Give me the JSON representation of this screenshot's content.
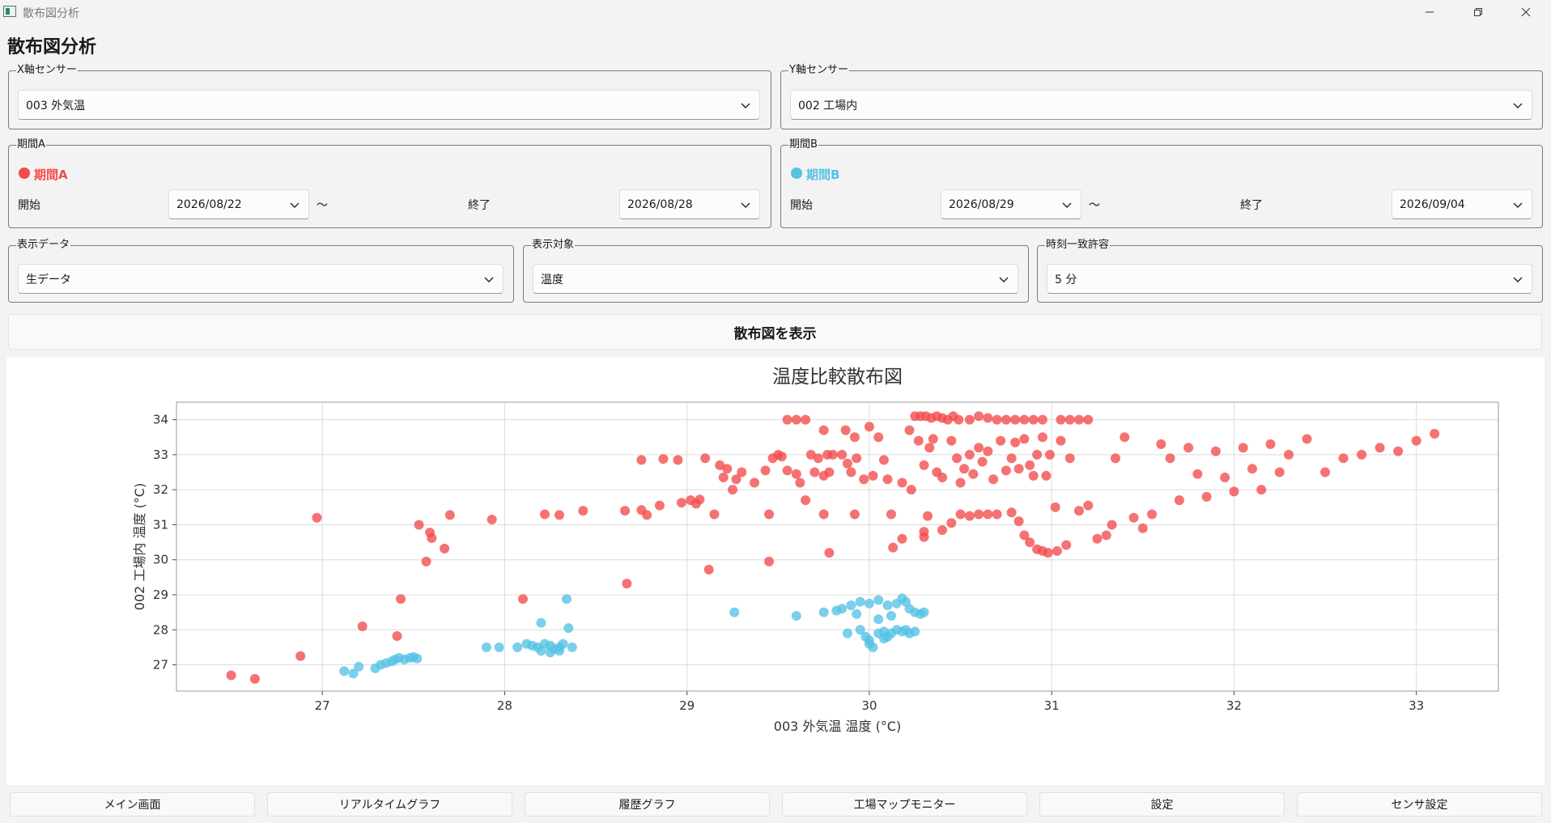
{
  "window": {
    "title": "散布図分析",
    "minimize_icon": "minimize-icon",
    "maximize_icon": "restore-icon",
    "close_icon": "close-icon"
  },
  "page_title": "散布図分析",
  "x_sensor": {
    "legend": "X軸センサー",
    "value": "003 外気温"
  },
  "y_sensor": {
    "legend": "Y軸センサー",
    "value": "002 工場内"
  },
  "period_a": {
    "legend": "期間A",
    "name": "期間A",
    "color": "#f44a4a",
    "start_label": "開始",
    "tilde": "〜",
    "end_label": "終了",
    "start": "2026/08/22",
    "end": "2026/08/28"
  },
  "period_b": {
    "legend": "期間B",
    "name": "期間B",
    "color": "#55c2e4",
    "start_label": "開始",
    "tilde": "〜",
    "end_label": "終了",
    "start": "2026/08/29",
    "end": "2026/09/04"
  },
  "display_data": {
    "legend": "表示データ",
    "value": "生データ"
  },
  "display_target": {
    "legend": "表示対象",
    "value": "温度"
  },
  "time_tolerance": {
    "legend": "時刻一致許容",
    "value": "5 分"
  },
  "show_button": "散布図を表示",
  "nav": [
    "メイン画面",
    "リアルタイムグラフ",
    "履歴グラフ",
    "工場マップモニター",
    "設定",
    "センサ設定"
  ],
  "chart_data": {
    "type": "scatter",
    "title": "温度比較散布図",
    "xlabel": "003 外気温 温度 (°C)",
    "ylabel": "002 工場内 温度 (°C)",
    "xlim": [
      26.2,
      33.45
    ],
    "ylim": [
      26.25,
      34.5
    ],
    "xticks": [
      27,
      28,
      29,
      30,
      31,
      32,
      33
    ],
    "yticks": [
      27,
      28,
      29,
      30,
      31,
      32,
      33,
      34
    ],
    "grid": true,
    "series": [
      {
        "period": "A",
        "color": "#f44a4a",
        "points": [
          [
            26.5,
            26.7
          ],
          [
            26.63,
            26.6
          ],
          [
            26.88,
            27.25
          ],
          [
            26.97,
            31.2
          ],
          [
            27.22,
            28.1
          ],
          [
            27.41,
            27.82
          ],
          [
            27.43,
            28.88
          ],
          [
            27.53,
            31.0
          ],
          [
            27.57,
            29.95
          ],
          [
            27.59,
            30.78
          ],
          [
            27.6,
            30.62
          ],
          [
            27.67,
            30.32
          ],
          [
            27.7,
            31.28
          ],
          [
            27.93,
            31.15
          ],
          [
            28.1,
            28.88
          ],
          [
            28.22,
            31.3
          ],
          [
            28.3,
            31.28
          ],
          [
            28.43,
            31.4
          ],
          [
            28.66,
            31.4
          ],
          [
            28.67,
            29.32
          ],
          [
            28.75,
            31.42
          ],
          [
            28.78,
            31.28
          ],
          [
            28.85,
            31.55
          ],
          [
            28.75,
            32.85
          ],
          [
            28.87,
            32.88
          ],
          [
            28.95,
            32.85
          ],
          [
            28.97,
            31.63
          ],
          [
            29.02,
            31.7
          ],
          [
            29.05,
            31.6
          ],
          [
            29.07,
            31.72
          ],
          [
            29.1,
            32.9
          ],
          [
            29.12,
            29.72
          ],
          [
            29.15,
            31.3
          ],
          [
            29.18,
            32.7
          ],
          [
            29.2,
            32.35
          ],
          [
            29.22,
            32.6
          ],
          [
            29.25,
            32.0
          ],
          [
            29.27,
            32.3
          ],
          [
            29.3,
            32.5
          ],
          [
            29.37,
            32.2
          ],
          [
            29.43,
            32.55
          ],
          [
            29.45,
            29.95
          ],
          [
            29.45,
            31.3
          ],
          [
            29.47,
            32.9
          ],
          [
            29.5,
            33.0
          ],
          [
            29.55,
            32.55
          ],
          [
            29.6,
            32.45
          ],
          [
            29.62,
            32.2
          ],
          [
            29.65,
            31.7
          ],
          [
            29.7,
            32.5
          ],
          [
            29.75,
            32.4
          ],
          [
            29.52,
            32.95
          ],
          [
            29.68,
            33.0
          ],
          [
            29.72,
            32.9
          ],
          [
            29.77,
            33.0
          ],
          [
            29.8,
            33.0
          ],
          [
            29.78,
            32.5
          ],
          [
            29.85,
            33.0
          ],
          [
            29.88,
            32.75
          ],
          [
            29.9,
            32.5
          ],
          [
            29.93,
            32.9
          ],
          [
            29.97,
            32.3
          ],
          [
            29.75,
            33.7
          ],
          [
            29.87,
            33.7
          ],
          [
            29.92,
            33.5
          ],
          [
            29.75,
            31.3
          ],
          [
            29.78,
            30.2
          ],
          [
            29.92,
            31.3
          ],
          [
            30.0,
            33.8
          ],
          [
            30.02,
            32.4
          ],
          [
            30.05,
            33.5
          ],
          [
            30.08,
            32.85
          ],
          [
            30.1,
            32.3
          ],
          [
            30.12,
            31.3
          ],
          [
            30.13,
            30.35
          ],
          [
            30.18,
            32.2
          ],
          [
            30.22,
            33.7
          ],
          [
            30.23,
            32.0
          ],
          [
            30.27,
            33.4
          ],
          [
            30.3,
            32.7
          ],
          [
            30.33,
            33.2
          ],
          [
            30.35,
            33.45
          ],
          [
            30.37,
            32.5
          ],
          [
            30.4,
            32.35
          ],
          [
            30.45,
            33.4
          ],
          [
            30.48,
            32.9
          ],
          [
            30.5,
            32.2
          ],
          [
            30.52,
            32.6
          ],
          [
            30.55,
            33.0
          ],
          [
            30.57,
            32.45
          ],
          [
            30.6,
            33.2
          ],
          [
            30.62,
            32.8
          ],
          [
            30.65,
            33.1
          ],
          [
            30.68,
            32.3
          ],
          [
            30.72,
            33.4
          ],
          [
            30.75,
            32.55
          ],
          [
            30.78,
            32.9
          ],
          [
            30.8,
            33.35
          ],
          [
            30.82,
            32.6
          ],
          [
            30.85,
            33.45
          ],
          [
            30.88,
            32.7
          ],
          [
            30.9,
            32.4
          ],
          [
            30.92,
            33.0
          ],
          [
            30.95,
            33.5
          ],
          [
            30.97,
            32.4
          ],
          [
            30.99,
            33.0
          ],
          [
            30.18,
            30.6
          ],
          [
            30.3,
            30.65
          ],
          [
            30.3,
            30.8
          ],
          [
            30.32,
            31.25
          ],
          [
            30.4,
            30.85
          ],
          [
            30.45,
            31.05
          ],
          [
            30.5,
            31.3
          ],
          [
            30.55,
            31.25
          ],
          [
            30.6,
            31.3
          ],
          [
            30.65,
            31.3
          ],
          [
            30.7,
            31.3
          ],
          [
            30.78,
            31.35
          ],
          [
            30.82,
            31.1
          ],
          [
            30.85,
            30.7
          ],
          [
            30.88,
            30.5
          ],
          [
            30.92,
            30.3
          ],
          [
            30.95,
            30.25
          ],
          [
            30.98,
            30.2
          ],
          [
            31.03,
            30.25
          ],
          [
            31.08,
            30.42
          ],
          [
            31.02,
            31.5
          ],
          [
            31.05,
            33.4
          ],
          [
            31.1,
            32.9
          ],
          [
            31.15,
            31.4
          ],
          [
            31.2,
            31.55
          ],
          [
            31.25,
            30.6
          ],
          [
            31.3,
            30.7
          ],
          [
            31.33,
            31.0
          ],
          [
            31.35,
            32.9
          ],
          [
            31.4,
            33.5
          ],
          [
            31.45,
            31.2
          ],
          [
            31.5,
            30.9
          ],
          [
            31.55,
            31.3
          ],
          [
            31.6,
            33.3
          ],
          [
            31.65,
            32.9
          ],
          [
            31.7,
            31.7
          ],
          [
            31.75,
            33.2
          ],
          [
            31.8,
            32.45
          ],
          [
            31.85,
            31.8
          ],
          [
            31.9,
            33.1
          ],
          [
            31.95,
            32.35
          ],
          [
            32.0,
            31.95
          ],
          [
            32.05,
            33.2
          ],
          [
            32.1,
            32.6
          ],
          [
            32.15,
            32.0
          ],
          [
            32.2,
            33.3
          ],
          [
            32.25,
            32.5
          ],
          [
            32.3,
            33.0
          ],
          [
            32.4,
            33.45
          ],
          [
            32.5,
            32.5
          ],
          [
            32.6,
            32.9
          ],
          [
            32.7,
            33.0
          ],
          [
            32.8,
            33.2
          ],
          [
            32.9,
            33.1
          ],
          [
            33.0,
            33.4
          ],
          [
            33.1,
            33.6
          ],
          [
            29.55,
            34.0
          ],
          [
            29.6,
            34.0
          ],
          [
            29.65,
            34.0
          ],
          [
            30.25,
            34.1
          ],
          [
            30.28,
            34.1
          ],
          [
            30.31,
            34.1
          ],
          [
            30.34,
            34.05
          ],
          [
            30.37,
            34.1
          ],
          [
            30.4,
            34.05
          ],
          [
            30.43,
            34.0
          ],
          [
            30.46,
            34.1
          ],
          [
            30.49,
            34.0
          ],
          [
            30.55,
            34.0
          ],
          [
            30.6,
            34.1
          ],
          [
            30.65,
            34.05
          ],
          [
            30.7,
            34.0
          ],
          [
            30.75,
            34.0
          ],
          [
            30.8,
            34.0
          ],
          [
            30.85,
            34.0
          ],
          [
            30.9,
            34.0
          ],
          [
            30.95,
            34.0
          ],
          [
            31.05,
            34.0
          ],
          [
            31.1,
            34.0
          ],
          [
            31.15,
            34.0
          ],
          [
            31.2,
            34.0
          ]
        ]
      },
      {
        "period": "B",
        "color": "#55c2e4",
        "points": [
          [
            27.12,
            26.82
          ],
          [
            27.17,
            26.75
          ],
          [
            27.2,
            26.95
          ],
          [
            27.29,
            26.9
          ],
          [
            27.32,
            27.0
          ],
          [
            27.35,
            27.05
          ],
          [
            27.38,
            27.1
          ],
          [
            27.4,
            27.15
          ],
          [
            27.42,
            27.2
          ],
          [
            27.45,
            27.15
          ],
          [
            27.48,
            27.2
          ],
          [
            27.5,
            27.22
          ],
          [
            27.52,
            27.18
          ],
          [
            27.9,
            27.5
          ],
          [
            27.97,
            27.5
          ],
          [
            28.07,
            27.5
          ],
          [
            28.12,
            27.6
          ],
          [
            28.15,
            27.55
          ],
          [
            28.18,
            27.5
          ],
          [
            28.2,
            28.2
          ],
          [
            28.22,
            27.6
          ],
          [
            28.25,
            27.55
          ],
          [
            28.27,
            27.45
          ],
          [
            28.3,
            27.5
          ],
          [
            28.32,
            27.6
          ],
          [
            28.34,
            28.88
          ],
          [
            28.35,
            28.05
          ],
          [
            28.37,
            27.5
          ],
          [
            28.2,
            27.4
          ],
          [
            28.25,
            27.35
          ],
          [
            28.3,
            27.4
          ],
          [
            29.26,
            28.5
          ],
          [
            29.6,
            28.4
          ],
          [
            29.75,
            28.5
          ],
          [
            29.82,
            28.55
          ],
          [
            29.85,
            28.6
          ],
          [
            29.9,
            28.7
          ],
          [
            29.93,
            28.45
          ],
          [
            29.88,
            27.9
          ],
          [
            29.95,
            28.0
          ],
          [
            29.98,
            27.8
          ],
          [
            30.0,
            27.6
          ],
          [
            30.02,
            27.5
          ],
          [
            30.05,
            27.9
          ],
          [
            30.08,
            27.75
          ],
          [
            30.1,
            27.8
          ],
          [
            30.12,
            27.9
          ],
          [
            30.15,
            28.0
          ],
          [
            30.18,
            27.95
          ],
          [
            30.2,
            28.0
          ],
          [
            30.22,
            27.9
          ],
          [
            30.25,
            27.95
          ],
          [
            29.95,
            28.8
          ],
          [
            30.0,
            28.75
          ],
          [
            30.05,
            28.85
          ],
          [
            30.1,
            28.7
          ],
          [
            30.15,
            28.75
          ],
          [
            30.18,
            28.9
          ],
          [
            30.2,
            28.8
          ],
          [
            30.22,
            28.6
          ],
          [
            30.25,
            28.5
          ],
          [
            30.28,
            28.45
          ],
          [
            30.3,
            28.5
          ],
          [
            30.12,
            28.4
          ],
          [
            30.05,
            28.3
          ],
          [
            30.0,
            27.7
          ],
          [
            30.08,
            27.95
          ]
        ]
      }
    ]
  }
}
